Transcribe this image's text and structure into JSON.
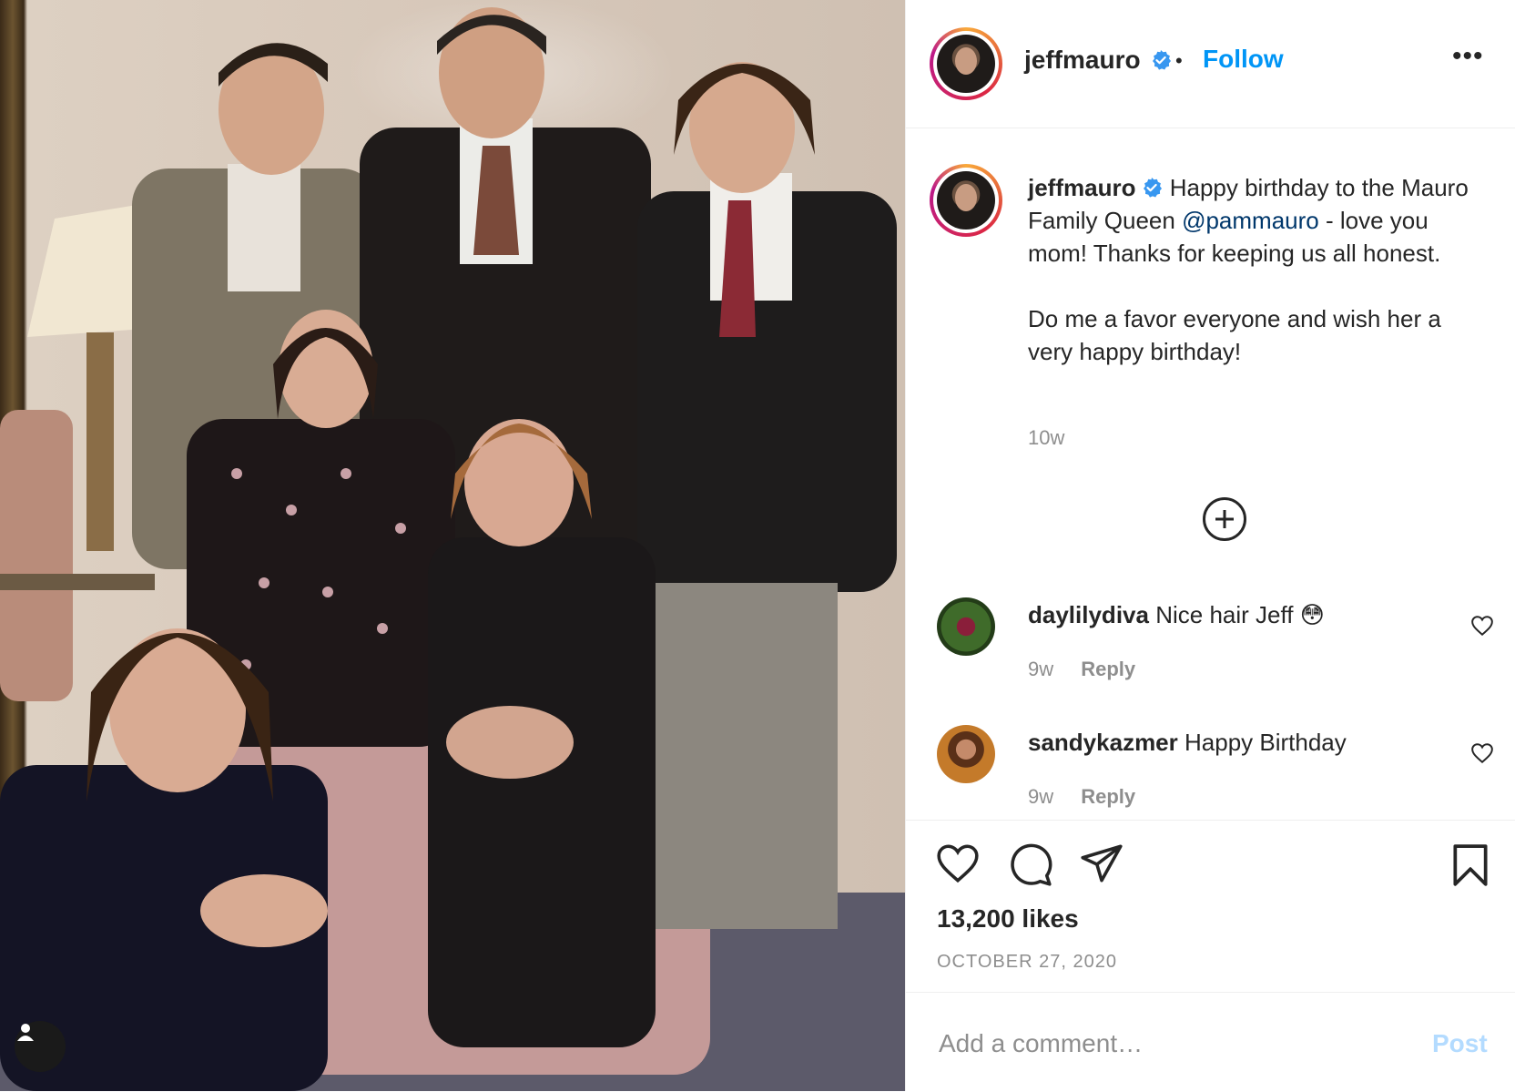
{
  "post": {
    "username": "jeffmauro",
    "follow_label": "Follow",
    "separator": "•",
    "more_label": "•••",
    "caption": {
      "part1": "Happy birthday to the Mauro Family Queen ",
      "mention": "@pammauro",
      "part2": " - love you mom! Thanks for keeping us all honest.",
      "part3": "Do me a favor everyone and wish her a very happy birthday!"
    },
    "caption_time": "10w",
    "comments": [
      {
        "username": "daylilydiva",
        "text": "Nice hair Jeff",
        "emoji": "😳",
        "time": "9w",
        "reply_label": "Reply"
      },
      {
        "username": "sandykazmer",
        "text": "Happy Birthday",
        "time": "9w",
        "reply_label": "Reply"
      }
    ],
    "likes": "13,200 likes",
    "date": "OCTOBER 27, 2020",
    "add_comment_placeholder": "Add a comment…",
    "post_button_label": "Post"
  },
  "icons": {
    "verified": "verified-badge-icon",
    "tag": "user-tag-icon",
    "more": "more-options-icon",
    "load_more": "plus-circle-icon",
    "like": "heart-icon",
    "comment": "comment-bubble-icon",
    "share": "paper-plane-icon",
    "save": "bookmark-icon"
  },
  "colors": {
    "accent": "#0095f6",
    "text": "#262626",
    "muted": "#8e8e8e",
    "mention": "#00376b",
    "post_disabled": "#b3dbff"
  }
}
